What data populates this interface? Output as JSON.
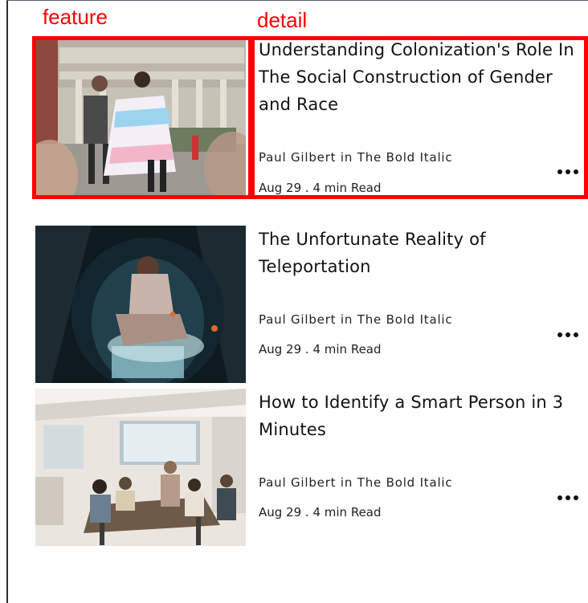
{
  "annotations": {
    "feature": {
      "label": "feature",
      "color": "#ff0000"
    },
    "detail": {
      "label": "detail",
      "color": "#ff0000"
    }
  },
  "articles": [
    {
      "title": "Understanding Colonization's Role In The Social Construction of Gender and Race",
      "author_line": "Paul Gilbert in The Bold Italic",
      "meta": "Aug 29 . 4 min Read",
      "image": "photo-pride-march",
      "menu_icon": "more-options-icon"
    },
    {
      "title": "The Unfortunate Reality of Teleportation",
      "author_line": "Paul Gilbert in The Bold Italic",
      "meta": "Aug 29 . 4 min Read",
      "image": "photo-teleport-pod",
      "menu_icon": "more-options-icon"
    },
    {
      "title": "How to Identify a Smart Person in 3 Minutes",
      "author_line": "Paul Gilbert in The Bold Italic",
      "meta": "Aug 29 . 4 min Read",
      "image": "photo-office-meeting",
      "menu_icon": "more-options-icon"
    }
  ]
}
